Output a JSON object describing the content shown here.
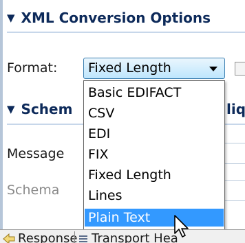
{
  "sections": {
    "xml_conversion": {
      "title": "XML Conversion Options",
      "toggle": "▼"
    },
    "schema": {
      "title": "Schema Settings",
      "title_visible": "Schem",
      "trailing_visible": "lique",
      "toggle": "▼"
    }
  },
  "format": {
    "label": "Format:",
    "selected_value": "Fixed Length",
    "options": [
      "Basic EDIFACT",
      "CSV",
      "EDI",
      "FIX",
      "Fixed Length",
      "Lines",
      "Plain Text"
    ],
    "highlighted_option": "Plain Text"
  },
  "fields": {
    "message_label": "Message",
    "schema_label": "Schema"
  },
  "tabs": {
    "response": "Response",
    "transport": "Transport Hea"
  },
  "colors": {
    "title_text": "#0d2a5a",
    "highlight": "#3399ff",
    "combo_border": "#3c7fb1"
  }
}
